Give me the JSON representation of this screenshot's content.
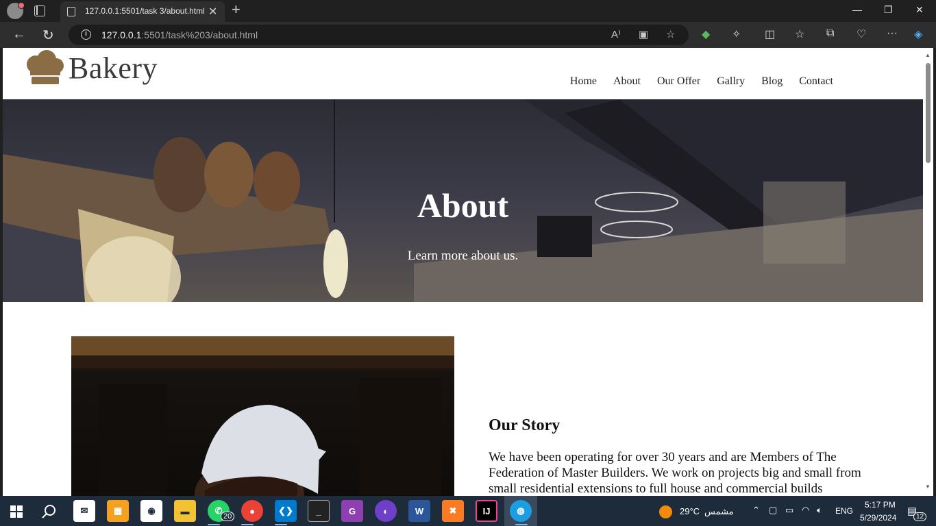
{
  "browser": {
    "tab_title": "127.0.0.1:5501/task 3/about.html",
    "url_host": "127.0.0.1",
    "url_rest": ":5501/task%203/about.html"
  },
  "site": {
    "logo_text": "Bakery",
    "nav": [
      "Home",
      "About",
      "Our Offer",
      "Gallry",
      "Blog",
      "Contact"
    ],
    "hero_title": "About",
    "hero_subtitle": "Learn more about us.",
    "story_title": "Our Story",
    "story_text": "We have been operating for over 30 years and are Members of The Federation of Master Builders. We work on projects big and small from small residential extensions to full house and commercial builds"
  },
  "taskbar": {
    "whatsapp_badge": "20",
    "weather_temp": "29°C",
    "weather_label": "مشمس",
    "language": "ENG",
    "time": "5:17 PM",
    "date": "5/29/2024",
    "notification_count": "12"
  },
  "colors": {
    "logo_brown": "#8a6d45",
    "taskbar_bg": "#1d2b3a"
  }
}
